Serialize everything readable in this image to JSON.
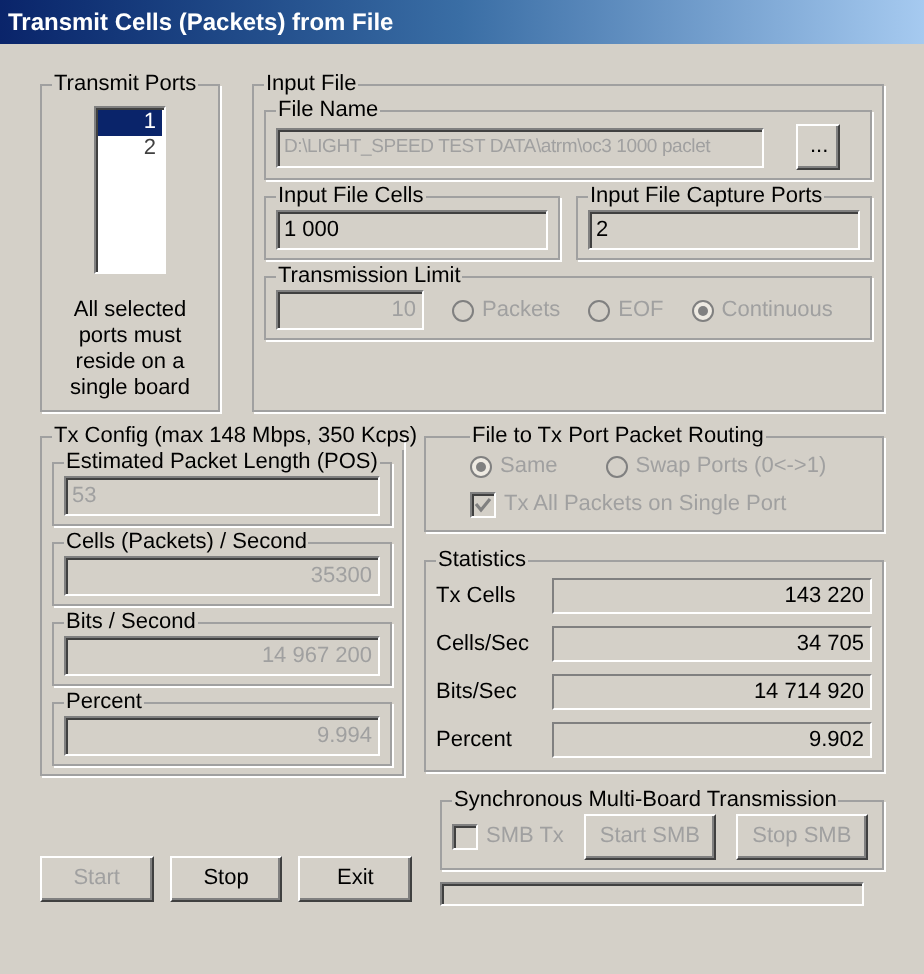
{
  "window": {
    "title": "Transmit Cells (Packets) from File"
  },
  "transmit_ports": {
    "title": "Transmit Ports",
    "items": [
      {
        "label": "1",
        "selected": true
      },
      {
        "label": "2",
        "selected": false
      }
    ],
    "note": "All selected ports must reside on a single board"
  },
  "input_file": {
    "title": "Input File",
    "file_name": {
      "title": "File Name",
      "value": "D:\\LIGHT_SPEED TEST DATA\\atrm\\oc3 1000 paclet",
      "disabled": true
    },
    "browse_button": "...",
    "cells": {
      "title": "Input File Cells",
      "value": "1 000",
      "disabled": false
    },
    "capture_ports": {
      "title": "Input File Capture Ports",
      "value": "2",
      "disabled": false
    },
    "transmission_limit": {
      "title": "Transmission Limit",
      "value": "10",
      "disabled": true,
      "options": [
        {
          "label": "Packets",
          "selected": false
        },
        {
          "label": "EOF",
          "selected": false
        },
        {
          "label": "Continuous",
          "selected": true
        }
      ]
    }
  },
  "tx_config": {
    "title": "Tx Config (max 148 Mbps, 350 Kcps)",
    "fields": [
      {
        "title": "Estimated Packet Length (POS)",
        "value": "53",
        "disabled": true
      },
      {
        "title": "Cells (Packets) / Second",
        "value": "35300",
        "disabled": true
      },
      {
        "title": "Bits / Second",
        "value": "14 967 200",
        "disabled": true
      },
      {
        "title": "Percent",
        "value": "9.994",
        "disabled": true
      }
    ]
  },
  "routing": {
    "title": "File to Tx Port Packet Routing",
    "disabled": true,
    "options": [
      {
        "label": "Same",
        "selected": true
      },
      {
        "label": "Swap Ports (0<->1)",
        "selected": false
      }
    ],
    "checkbox": {
      "label": "Tx All Packets on Single Port",
      "checked": true
    }
  },
  "statistics": {
    "title": "Statistics",
    "rows": [
      {
        "label": "Tx Cells",
        "value": "143 220"
      },
      {
        "label": "Cells/Sec",
        "value": "34 705"
      },
      {
        "label": "Bits/Sec",
        "value": "14 714 920"
      },
      {
        "label": "Percent",
        "value": "9.902"
      }
    ]
  },
  "smb": {
    "title": "Synchronous Multi-Board Transmission",
    "disabled": true,
    "checkbox": {
      "label": "SMB Tx",
      "checked": false
    },
    "buttons": [
      "Start SMB",
      "Stop SMB"
    ]
  },
  "buttons": [
    {
      "label": "Start",
      "disabled": true
    },
    {
      "label": "Stop",
      "disabled": false
    },
    {
      "label": "Exit",
      "disabled": false
    }
  ],
  "progress": {
    "level": 0
  }
}
